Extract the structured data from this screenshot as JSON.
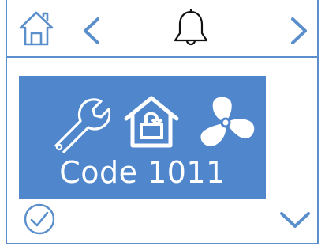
{
  "header": {
    "home_icon": "home-icon",
    "prev_icon": "chevron-left-icon",
    "bell_icon": "bell-icon",
    "next_icon": "chevron-right-icon"
  },
  "alarm": {
    "icons": [
      "wrench-icon",
      "home-return-icon",
      "fan-icon"
    ],
    "code_label": "Code 1011"
  },
  "footer": {
    "confirm_icon": "check-circle-icon",
    "down_icon": "chevron-down-icon"
  },
  "colors": {
    "accent": "#5b8fcc",
    "panel": "#4f86cc",
    "panel_text": "#ffffff"
  }
}
